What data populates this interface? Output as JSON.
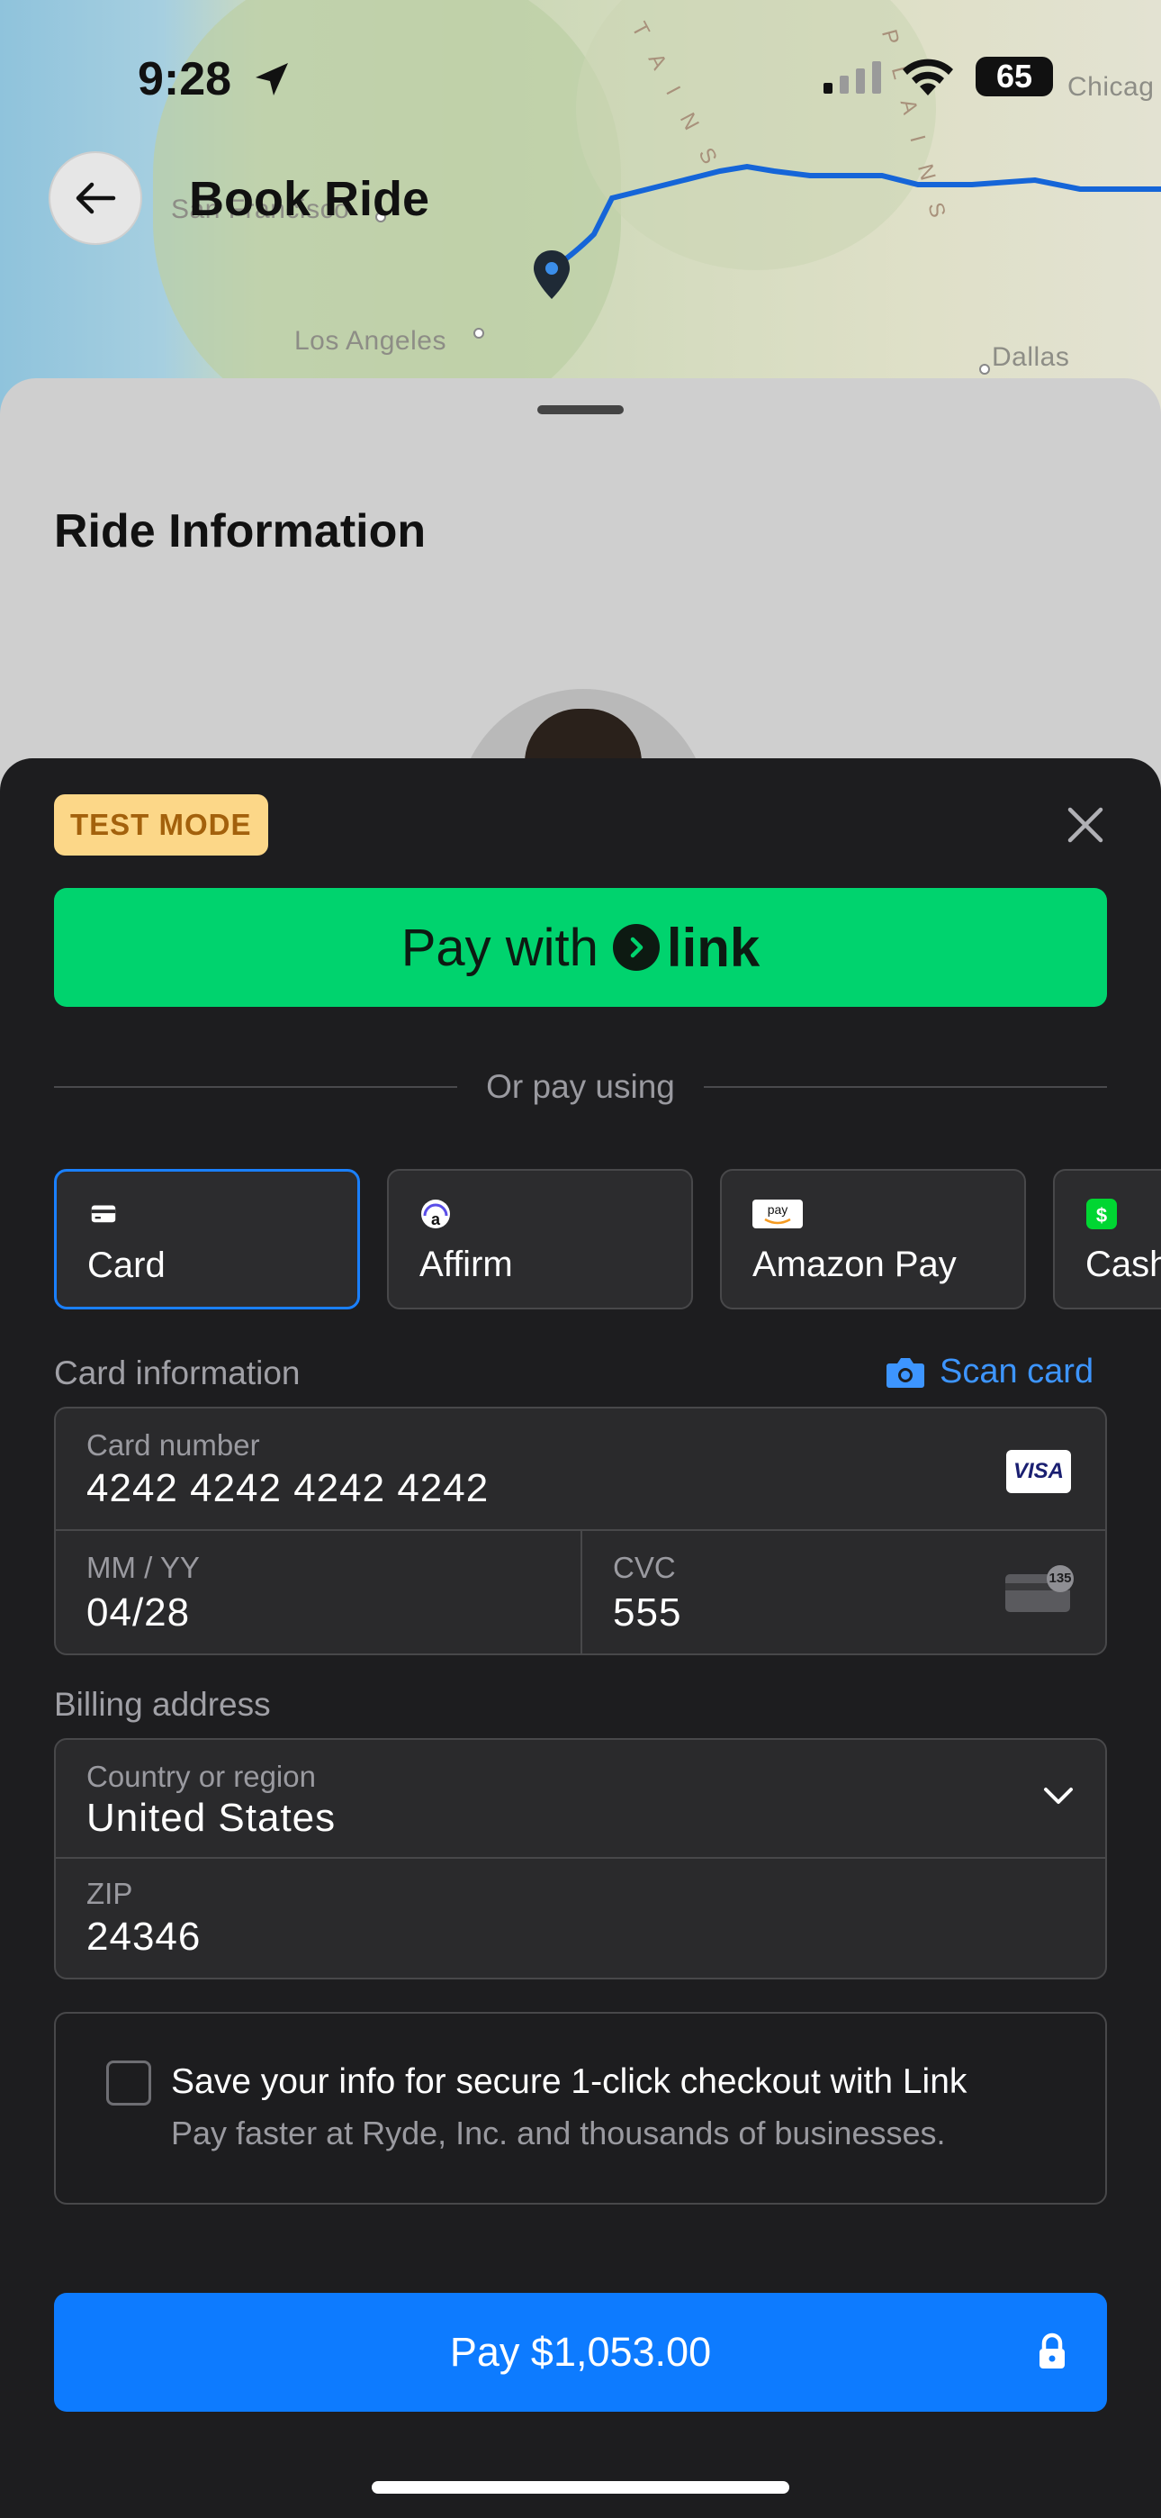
{
  "status_bar": {
    "time": "9:28",
    "battery": "65"
  },
  "map": {
    "cities": {
      "san_francisco": "San Francisco",
      "los_angeles": "Los Angeles",
      "dallas": "Dallas",
      "chicago": "Chicag"
    },
    "route_color": "#1565d8"
  },
  "header": {
    "title": "Book Ride"
  },
  "ride_sheet": {
    "title": "Ride Information"
  },
  "payment_sheet": {
    "test_badge": "TEST MODE",
    "link_button": {
      "prefix": "Pay with",
      "brand": "link"
    },
    "divider_text": "Or pay using",
    "methods": [
      {
        "label": "Card",
        "icon": "card-icon",
        "selected": true
      },
      {
        "label": "Affirm",
        "icon": "affirm-icon",
        "selected": false
      },
      {
        "label": "Amazon Pay",
        "icon": "amazon-pay-icon",
        "selected": false
      },
      {
        "label": "Cash",
        "icon": "cash-app-icon",
        "selected": false
      }
    ],
    "card_info": {
      "section_label": "Card information",
      "scan_card": "Scan card",
      "card_number_label": "Card number",
      "card_number": "4242 4242 4242 4242",
      "card_brand": "VISA",
      "expiry_label": "MM / YY",
      "expiry": "04/28",
      "cvc_label": "CVC",
      "cvc": "555",
      "cvc_icon_text": "135"
    },
    "billing": {
      "section_label": "Billing address",
      "country_label": "Country or region",
      "country": "United States",
      "zip_label": "ZIP",
      "zip": "24346"
    },
    "save_info": {
      "title": "Save your info for secure 1-click checkout with Link",
      "subtitle": "Pay faster at Ryde, Inc. and thousands of businesses.",
      "checked": false
    },
    "pay_button": "Pay $1,053.00"
  },
  "colors": {
    "link_green": "#00d36e",
    "pay_blue": "#0d7bff",
    "accent_blue": "#3d95ff",
    "badge_bg": "#fcd788",
    "badge_text": "#a3610c"
  }
}
